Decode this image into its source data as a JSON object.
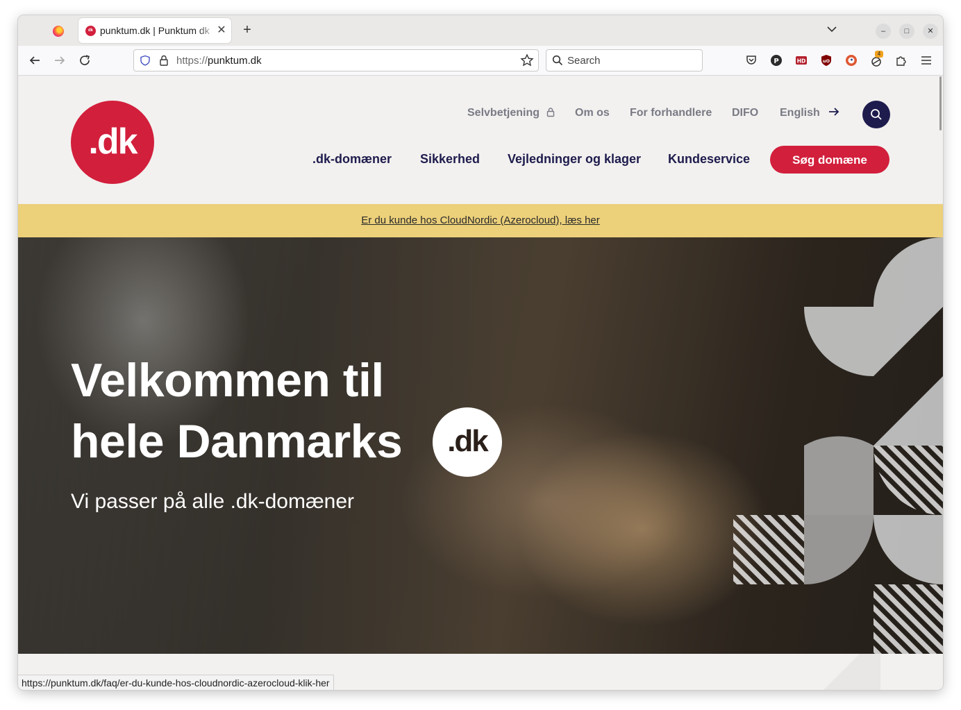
{
  "browser": {
    "tab": {
      "title": "punktum.dk | Punktum dk",
      "favicon_text": "dk"
    },
    "url": {
      "protocol": "https://",
      "host": "punktum.dk"
    },
    "search_placeholder": "Search",
    "extension_badge": "4",
    "status_url": "https://punktum.dk/faq/er-du-kunde-hos-cloudnordic-azerocloud-klik-her"
  },
  "site": {
    "logo_text": ".dk",
    "utility_nav": [
      {
        "label": "Selvbetjening"
      },
      {
        "label": "Om os"
      },
      {
        "label": "For forhandlere"
      },
      {
        "label": "DIFO"
      },
      {
        "label": "English"
      }
    ],
    "main_nav": [
      {
        "label": ".dk-domæner"
      },
      {
        "label": "Sikkerhed"
      },
      {
        "label": "Vejledninger og klager"
      },
      {
        "label": "Kundeservice"
      }
    ],
    "cta_label": "Søg domæne",
    "banner_text": "Er du kunde hos CloudNordic (Azerocloud), læs her",
    "hero": {
      "line1": "Velkommen til",
      "line2": "hele Danmarks",
      "badge": ".dk",
      "subtitle": "Vi passer på alle .dk-domæner"
    }
  },
  "colors": {
    "brand_red": "#d21f3c",
    "navy": "#1e1c4d",
    "banner": "#ecd07a"
  }
}
